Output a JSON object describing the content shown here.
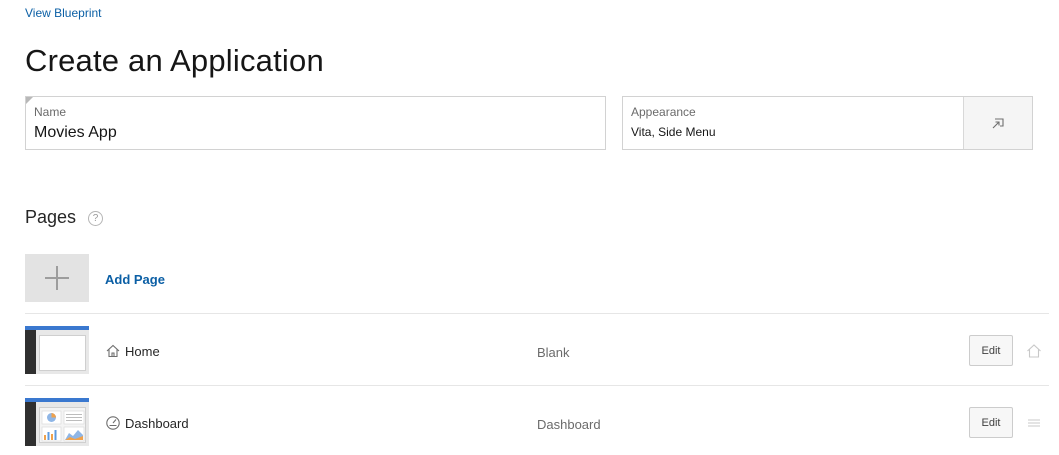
{
  "header": {
    "view_blueprint": "View Blueprint",
    "title": "Create an Application"
  },
  "name_field": {
    "label": "Name",
    "value": "Movies App"
  },
  "appearance_field": {
    "label": "Appearance",
    "value": "Vita, Side Menu",
    "button_icon": "select-popup-icon"
  },
  "pages": {
    "heading": "Pages",
    "help_glyph": "?",
    "add_label": "Add Page",
    "rows": [
      {
        "name": "Home",
        "type": "Blank",
        "edit_label": "Edit",
        "icon": "home-icon",
        "trailing_icon": "home-icon"
      },
      {
        "name": "Dashboard",
        "type": "Dashboard",
        "edit_label": "Edit",
        "icon": "dashboard-icon",
        "trailing_icon": "drag-handle-icon"
      }
    ]
  },
  "colors": {
    "link": "#0b5fa5",
    "thumb_topbar": "#3a78cf",
    "thumb_sidebar": "#2f2f2f"
  }
}
